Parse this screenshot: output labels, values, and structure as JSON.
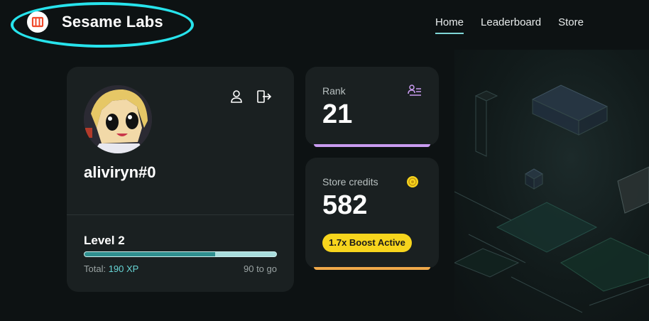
{
  "header": {
    "brand_name": "Sesame Labs",
    "logo_icon": "sesame-logo-icon",
    "nav": [
      {
        "label": "Home",
        "active": true
      },
      {
        "label": "Leaderboard",
        "active": false
      },
      {
        "label": "Store",
        "active": false
      }
    ]
  },
  "profile": {
    "username": "aliviryn#0",
    "avatar_icon": "anime-avatar",
    "actions": [
      "profile-icon",
      "logout-icon"
    ],
    "level_label": "Level 2",
    "total_label": "Total: ",
    "total_xp": "190 XP",
    "to_go": "90 to go",
    "progress_fraction": 0.68
  },
  "rank": {
    "label": "Rank",
    "value": "21",
    "icon": "users-list-icon"
  },
  "credits": {
    "label": "Store credits",
    "value": "582",
    "icon": "coin-icon",
    "boost": "1.7x Boost Active"
  },
  "colors": {
    "accent_teal": "#67d4d4",
    "rank_accent": "#c99bf0",
    "credits_accent": "#f0a94a",
    "boost_yellow": "#f7d51d",
    "logo_red": "#f04a2b",
    "highlight": "#27e3ec"
  }
}
